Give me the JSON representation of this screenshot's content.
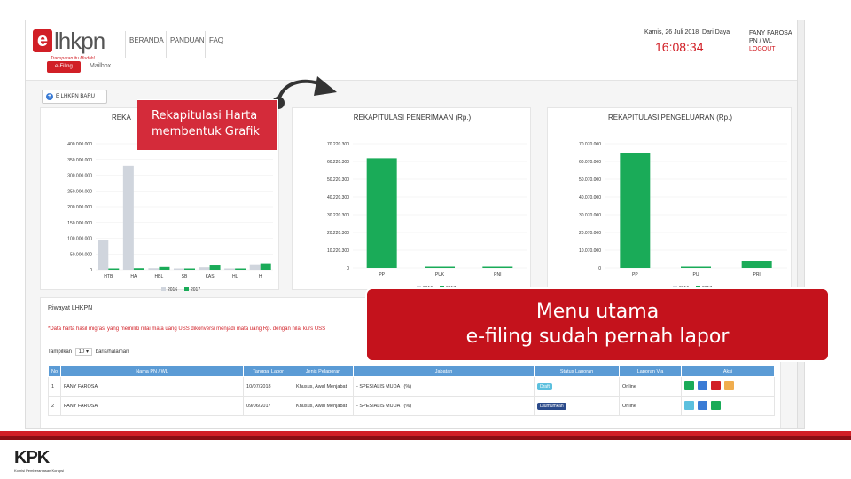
{
  "header": {
    "logo_e": "e",
    "logo_text": "lhkpn",
    "logo_tagline": "Transparan itu Mudah!",
    "nav": [
      "BERANDA",
      "PANDUAN",
      "FAQ"
    ],
    "efiling_button": "e-Filing",
    "mailbox": "Mailbox",
    "date": "Kamis, 26 Juli 2018",
    "greeting": "Dari Daya",
    "clock": "16:08:34",
    "user_name": "FANY FAROSA",
    "user_role": "PN / WL",
    "logout": "LOGOUT"
  },
  "new_button": "E LHKPN BARU",
  "legend": {
    "y2016": "2016",
    "y2017": "2017",
    "color2016": "#d0d5dd",
    "color2017": "#1aab58"
  },
  "chart_data": [
    {
      "type": "bar",
      "title": "REKAPITULASI HARTA",
      "title_visible": "REKA",
      "categories": [
        "HTB",
        "HA",
        "HBL",
        "SB",
        "KAS",
        "HL",
        "H"
      ],
      "yticks": [
        "400.000.000",
        "350.000.000",
        "300.000.000",
        "250.000.000",
        "200.000.000",
        "150.000.000",
        "100.000.000",
        "50.000.000",
        "0"
      ],
      "ylim": [
        0,
        400000000
      ],
      "series": [
        {
          "name": "2016",
          "values": [
            95000000,
            330000000,
            5000000,
            2000000,
            8000000,
            1000000,
            15000000
          ]
        },
        {
          "name": "2017",
          "values": [
            3000000,
            5000000,
            9000000,
            4000000,
            14000000,
            2000000,
            18000000
          ]
        }
      ]
    },
    {
      "type": "bar",
      "title": "REKAPITULASI PENERIMAAN (Rp.)",
      "categories": [
        "PP",
        "PUK",
        "PNI"
      ],
      "yticks": [
        "70.220.300",
        "60.220.300",
        "50.220.300",
        "40.220.300",
        "30.220.300",
        "20.220.300",
        "10.220.300",
        "0"
      ],
      "ylim": [
        0,
        70220300
      ],
      "series": [
        {
          "name": "2016",
          "values": [
            0,
            0,
            0
          ]
        },
        {
          "name": "2017",
          "values": [
            62000000,
            300000,
            300000
          ]
        }
      ]
    },
    {
      "type": "bar",
      "title": "REKAPITULASI PENGELUARAN (Rp.)",
      "categories": [
        "PP",
        "PU",
        "PRI"
      ],
      "yticks": [
        "70.070.000",
        "60.070.000",
        "50.070.000",
        "40.070.000",
        "30.070.000",
        "20.070.000",
        "10.070.000",
        "0"
      ],
      "ylim": [
        0,
        70070000
      ],
      "series": [
        {
          "name": "2016",
          "values": [
            0,
            0,
            0
          ]
        },
        {
          "name": "2017",
          "values": [
            65000000,
            400000,
            4000000
          ]
        }
      ]
    }
  ],
  "riwayat": {
    "title": "Riwayat LHKPN",
    "note": "*Data harta hasil migrasi yang memiliki nilai mata uang USS dikonversi menjadi mata uang Rp. dengan nilai kurs USS",
    "show_label": "Tampilkan",
    "show_value": "10",
    "show_suffix": "baris/halaman",
    "columns": [
      "No",
      "Nama PN / WL",
      "Tanggal Lapor",
      "Jenis Pelaporan",
      "Jabatan",
      "Status Laporan",
      "Laporan Via",
      "Aksi"
    ],
    "rows": [
      {
        "no": "1",
        "name": "FANY FAROSA",
        "date": "10/07/2018",
        "type": "Khusus, Awal Menjabat",
        "position": "- SPESIALIS MUDA I (%)",
        "status": "Draft",
        "status_color": "#5bc0de",
        "via": "Online",
        "actions": [
          "#1aab58",
          "#3a7bd5",
          "#d11f26",
          "#f0ad4e"
        ]
      },
      {
        "no": "2",
        "name": "FANY FAROSA",
        "date": "09/06/2017",
        "type": "Khusus, Awal Menjabat",
        "position": "- SPESIALIS MUDA I (%)",
        "status": "Diumumkan",
        "status_color": "#2a4a8a",
        "via": "Online",
        "actions": [
          "#5bc0de",
          "#3a7bd5",
          "#1aab58"
        ]
      }
    ]
  },
  "callouts": {
    "harta": [
      "Rekapitulasi Harta",
      "membentuk Grafik"
    ],
    "menu": [
      "Menu utama",
      "e-filing sudah pernah lapor"
    ]
  },
  "footer": {
    "brand": "KPK",
    "subtitle": "Komisi Pemberantasan Korupsi",
    "brand_color": "#d11f26"
  }
}
